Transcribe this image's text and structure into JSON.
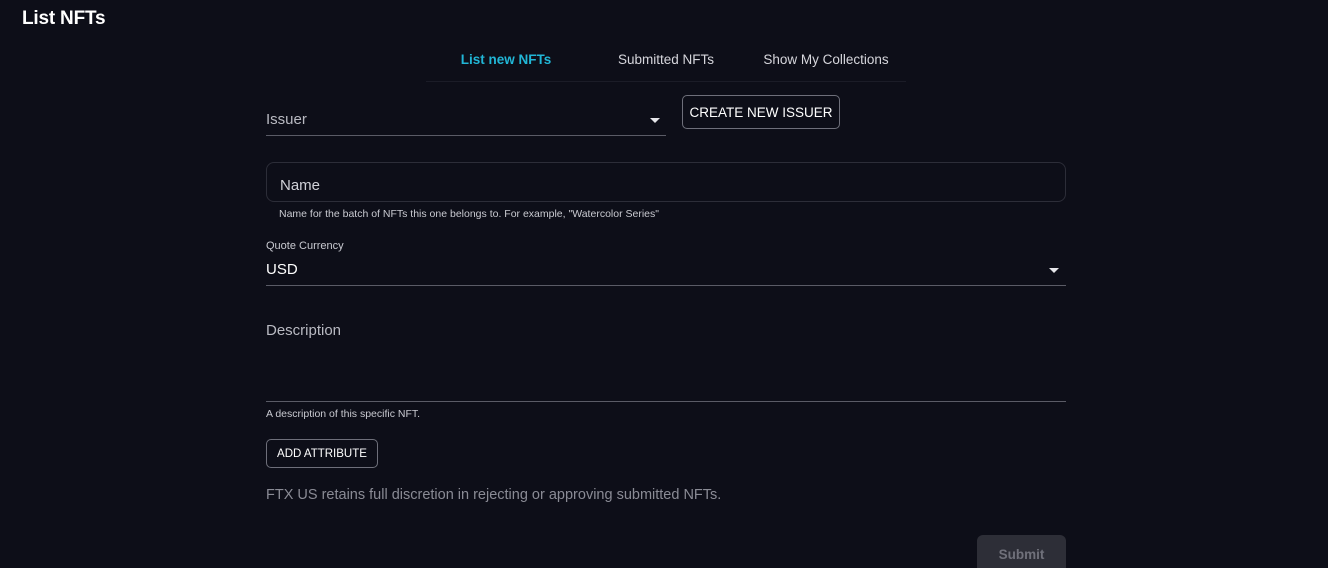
{
  "page": {
    "title": "List NFTs"
  },
  "tabs": [
    {
      "label": "List new NFTs",
      "active": true
    },
    {
      "label": "Submitted NFTs",
      "active": false
    },
    {
      "label": "Show My Collections",
      "active": false
    }
  ],
  "form": {
    "issuer": {
      "label": "Issuer",
      "icon": "chevron-down-icon"
    },
    "create_issuer_label": "CREATE NEW ISSUER",
    "name": {
      "placeholder": "Name",
      "value": "",
      "helper": "Name for the batch of NFTs this one belongs to. For example, \"Watercolor Series\""
    },
    "quote_currency": {
      "label": "Quote Currency",
      "value": "USD",
      "icon": "chevron-down-icon"
    },
    "description": {
      "placeholder": "Description",
      "value": "",
      "helper": "A description of this specific NFT."
    },
    "add_attribute_label": "ADD ATTRIBUTE",
    "disclaimer": "FTX US retains full discretion in rejecting or approving submitted NFTs.",
    "submit_label": "Submit",
    "submit_disabled": true
  },
  "colors": {
    "background": "#0d0e18",
    "accent": "#21b6d6",
    "text": "#ffffff",
    "muted": "#8a8b95",
    "disabled_button": "#2d2e37"
  }
}
